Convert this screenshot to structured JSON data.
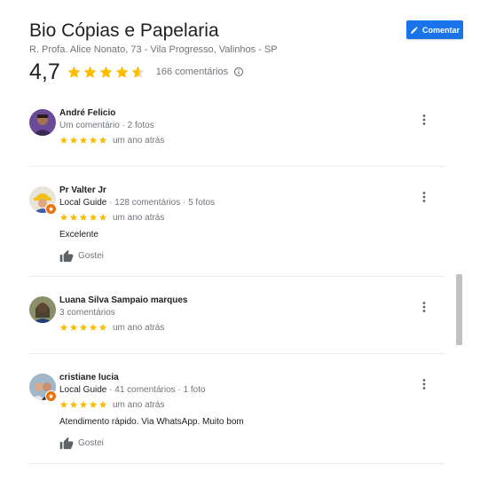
{
  "place": {
    "title": "Bio Cópias e Papelaria",
    "address": "R. Profa. Alice Nonato, 73 - Vila Progresso, Valinhos - SP"
  },
  "comment_button": {
    "label": "Comentar",
    "icon": "pencil-icon",
    "color": "#1a73e8"
  },
  "rating": {
    "value": "4,7",
    "stars": 4.7,
    "count_label": "166 comentários",
    "star_color": "#fbbc04"
  },
  "reviews": [
    {
      "name": "André Felicio",
      "meta": "Um comentário · 2 fotos",
      "local_guide": false,
      "stars": 5,
      "date": "um ano atrás",
      "text": "",
      "like_label": ""
    },
    {
      "name": "Pr Valter Jr",
      "local_guide_label": "Local Guide",
      "meta": " · 128 comentários · 5 fotos",
      "local_guide": true,
      "stars": 5,
      "date": "um ano atrás",
      "text": "Excelente",
      "like_label": "Gostei"
    },
    {
      "name": "Luana Silva Sampaio marques",
      "meta": "3 comentários",
      "local_guide": false,
      "stars": 5,
      "date": "um ano atrás",
      "text": "",
      "like_label": ""
    },
    {
      "name": "cristiane lucia",
      "local_guide_label": "Local Guide",
      "meta": " · 41 comentários · 1 foto",
      "local_guide": true,
      "stars": 5,
      "date": "um ano atrás",
      "text": "Atendimento rápido. Via WhatsApp. Muito bom",
      "like_label": "Gostei"
    }
  ]
}
